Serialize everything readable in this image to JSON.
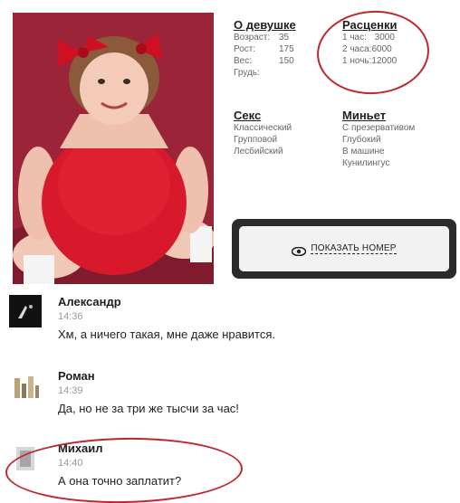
{
  "profile": {
    "about": {
      "title": "О девушке",
      "rows": [
        {
          "label": "Возраст:",
          "value": "35"
        },
        {
          "label": "Рост:",
          "value": "175"
        },
        {
          "label": "Вес:",
          "value": "150"
        },
        {
          "label": "Грудь:",
          "value": ""
        }
      ]
    },
    "prices": {
      "title": "Расценки",
      "rows": [
        {
          "label": "1 час:",
          "value": "3000"
        },
        {
          "label": "2 часа:",
          "value": "6000"
        },
        {
          "label": "1 ночь:",
          "value": "12000"
        }
      ]
    },
    "sex": {
      "title": "Секс",
      "items": [
        "Классический",
        "Групповой",
        "Лесбийский"
      ]
    },
    "oral": {
      "title": "Миньет",
      "items": [
        "С презервативом",
        "Глубокий",
        "В машине",
        "Кунилингус"
      ]
    },
    "show_button_label": "ПОКАЗАТЬ НОМЕР"
  },
  "comments": [
    {
      "author": "Александр",
      "time": "14:36",
      "text": "Хм, а ничего такая, мне даже нравится."
    },
    {
      "author": "Роман",
      "time": "14:39",
      "text": "Да, но не за три же тысчи за час!"
    },
    {
      "author": "Михаил",
      "time": "14:40",
      "text": "А она точно заплатит?"
    }
  ],
  "colors": {
    "annotation_circle": "#c0272d",
    "button_frame": "#2b2b2b",
    "photo_background": "#a62a3e"
  }
}
